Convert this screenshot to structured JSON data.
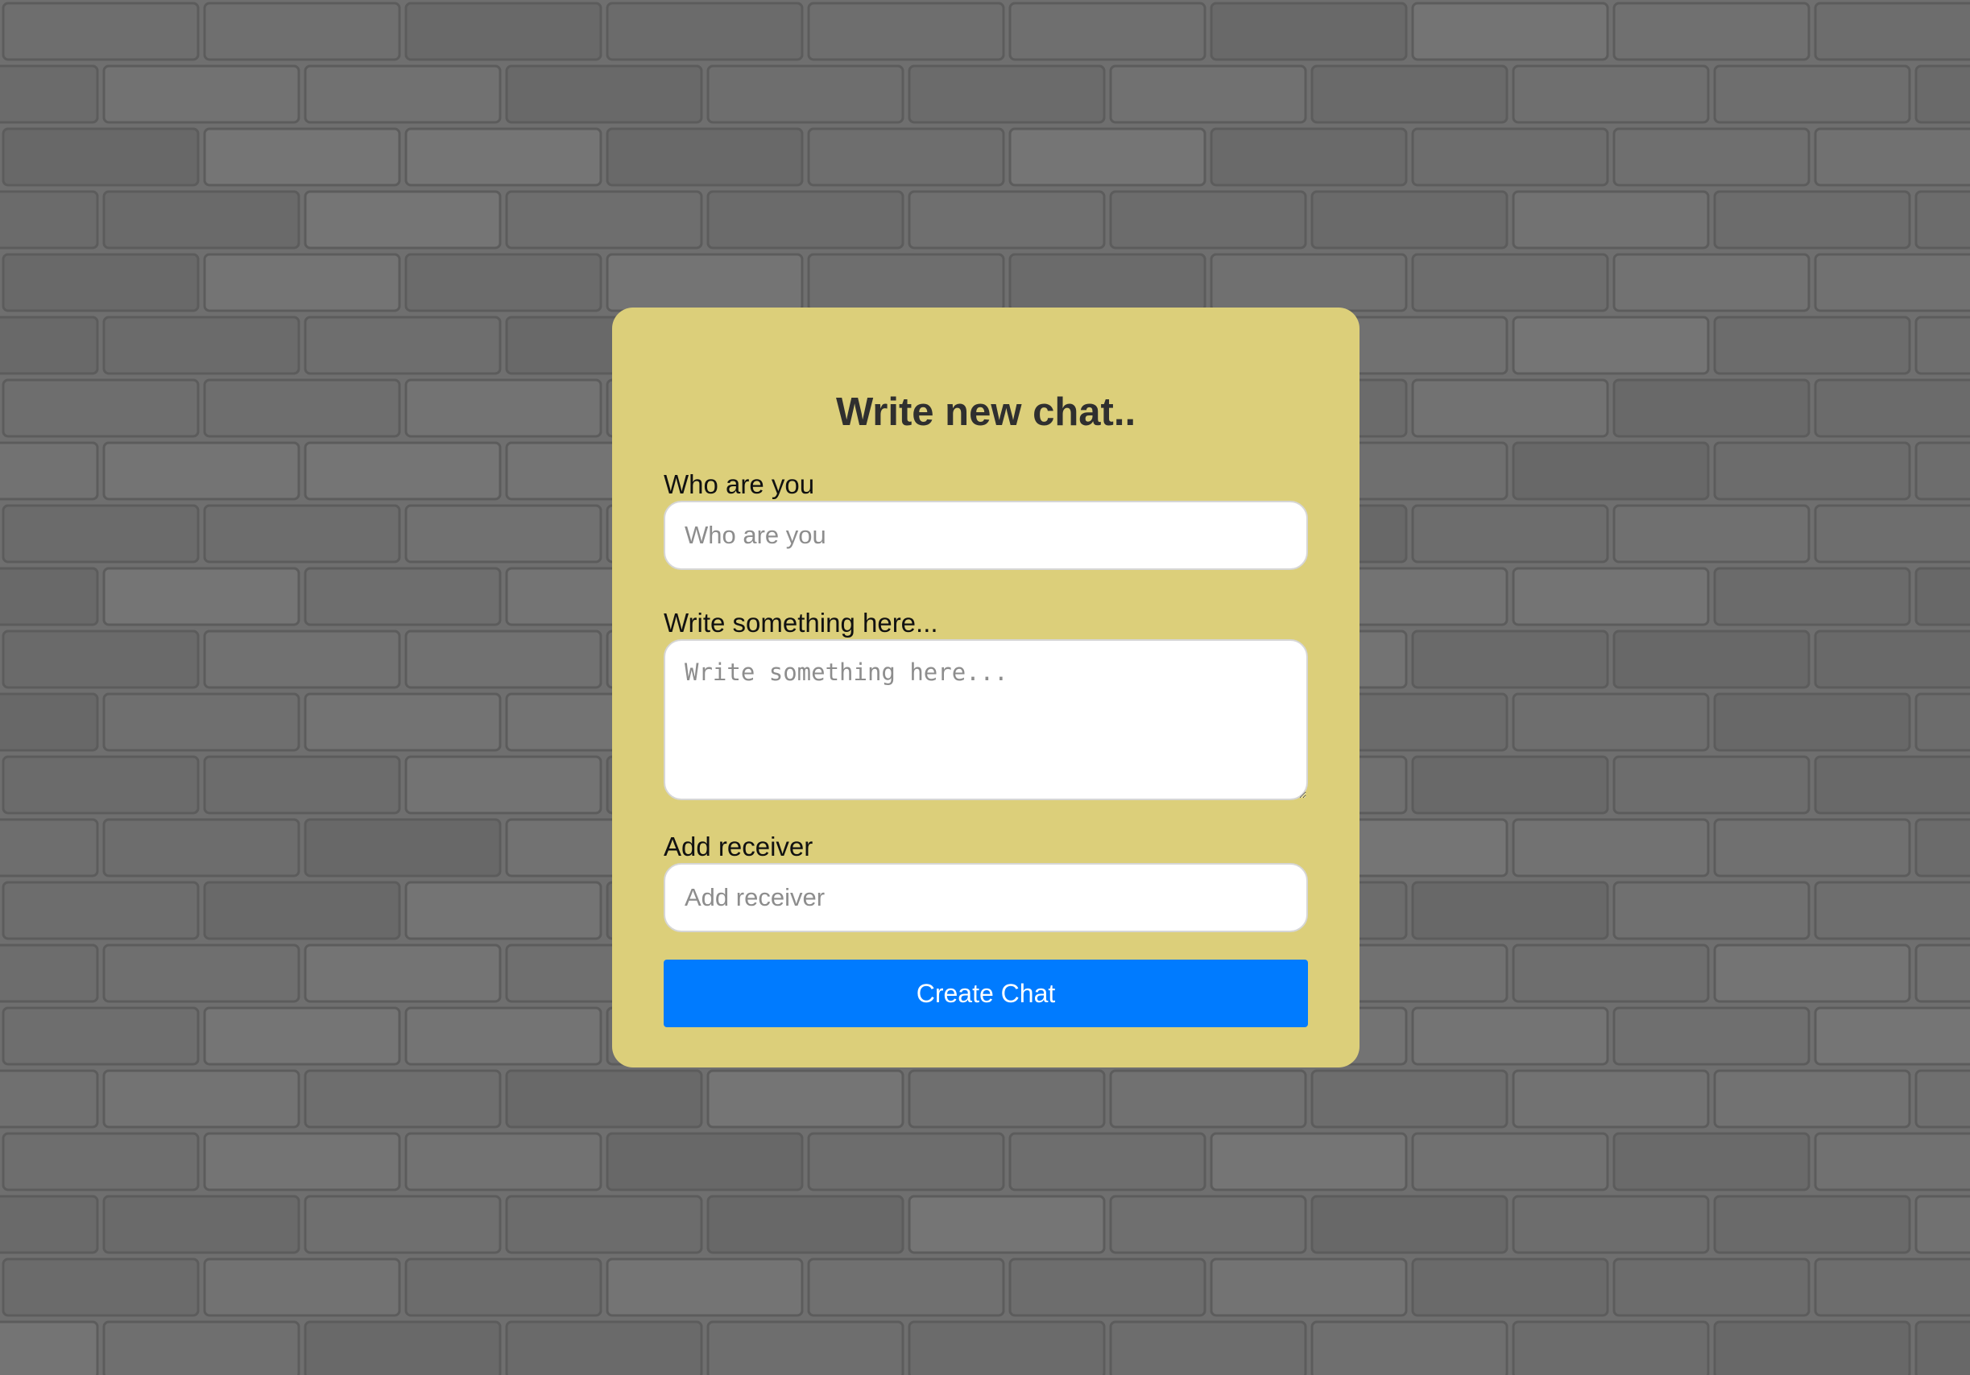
{
  "form": {
    "title": "Write new chat..",
    "sender": {
      "label": "Who are you",
      "placeholder": "Who are you",
      "value": ""
    },
    "message": {
      "label": "Write something here...",
      "placeholder": "Write something here...",
      "value": ""
    },
    "receiver": {
      "label": "Add receiver",
      "placeholder": "Add receiver",
      "value": ""
    },
    "submit_label": "Create Chat"
  },
  "colors": {
    "card_background": "#dccf7a",
    "button_background": "#007bff",
    "button_text": "#ffffff",
    "title_text": "#2f2f2f",
    "wall": "#6f6f6f"
  }
}
